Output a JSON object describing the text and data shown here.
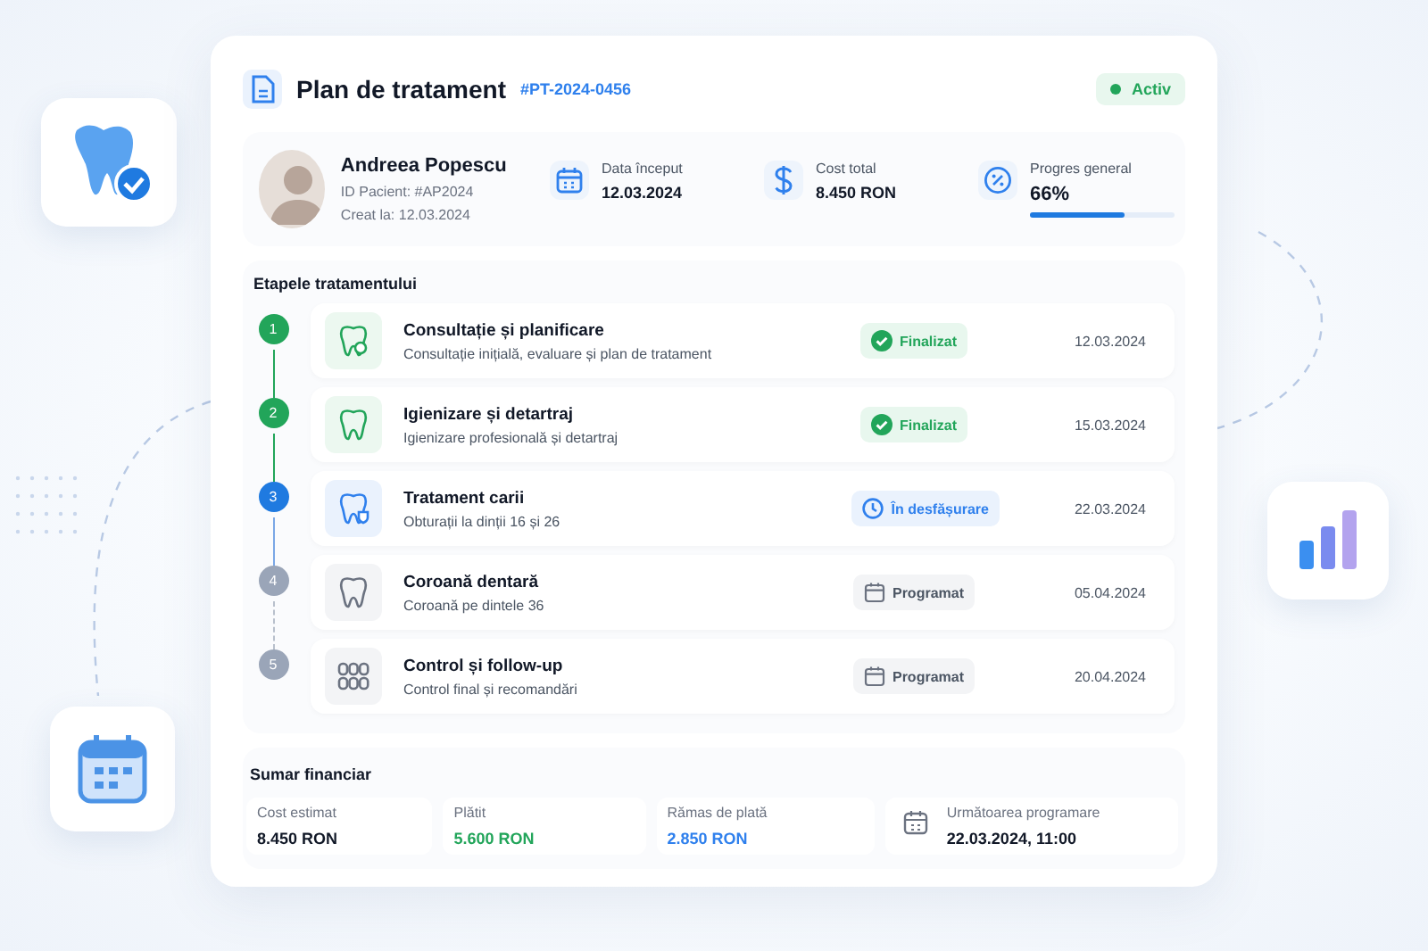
{
  "header": {
    "title": "Plan de tratament",
    "code": "#PT-2024-0456",
    "status": {
      "label": "Activ",
      "active": true
    }
  },
  "patient": {
    "name": "Andreea Popescu",
    "id_line": "ID Pacient: #AP2024",
    "created_line": "Creat la: 12.03.2024"
  },
  "stats": [
    {
      "kind": "date",
      "label": "Data început",
      "value": "12.03.2024"
    },
    {
      "kind": "cost",
      "label": "Cost total",
      "value": "8.450 RON"
    },
    {
      "kind": "progress",
      "label": "Progres general",
      "value": "66%",
      "level": 0.66
    }
  ],
  "stages": {
    "title": "Etapele tratamentului",
    "items": [
      {
        "number": "1",
        "title": "Consultație și planificare",
        "description": "Consultație inițială, evaluare și plan de tratament",
        "kind": "done",
        "status_label": "Finalizat",
        "date": "12.03.2024"
      },
      {
        "number": "2",
        "title": "Igienizare și detartraj",
        "description": "Igienizare profesională și detartraj",
        "kind": "done",
        "status_label": "Finalizat",
        "date": "15.03.2024"
      },
      {
        "number": "3",
        "title": "Tratament carii",
        "description": "Obturații la dinții 16 și 26",
        "kind": "active",
        "status_label": "În desfășurare",
        "date": "22.03.2024"
      },
      {
        "number": "4",
        "title": "Coroană dentară",
        "description": "Coroană pe dintele 36",
        "kind": "scheduled",
        "status_label": "Programat",
        "date": "05.04.2024"
      },
      {
        "number": "5",
        "title": "Control și follow-up",
        "description": "Control final și recomandări",
        "kind": "scheduled",
        "status_label": "Programat",
        "date": "20.04.2024"
      }
    ]
  },
  "finance": {
    "title": "Sumar financiar",
    "items": [
      {
        "label": "Cost estimat",
        "value": "8.450 RON",
        "color": "#111827"
      },
      {
        "label": "Plătit",
        "value": "5.600 RON",
        "color": "#22a55a"
      },
      {
        "label": "Rămas de plată",
        "value": "2.850 RON",
        "color": "#2f80ed"
      }
    ],
    "next": {
      "label": "Următoarea programare",
      "value": "22.03.2024, 11:00"
    }
  }
}
